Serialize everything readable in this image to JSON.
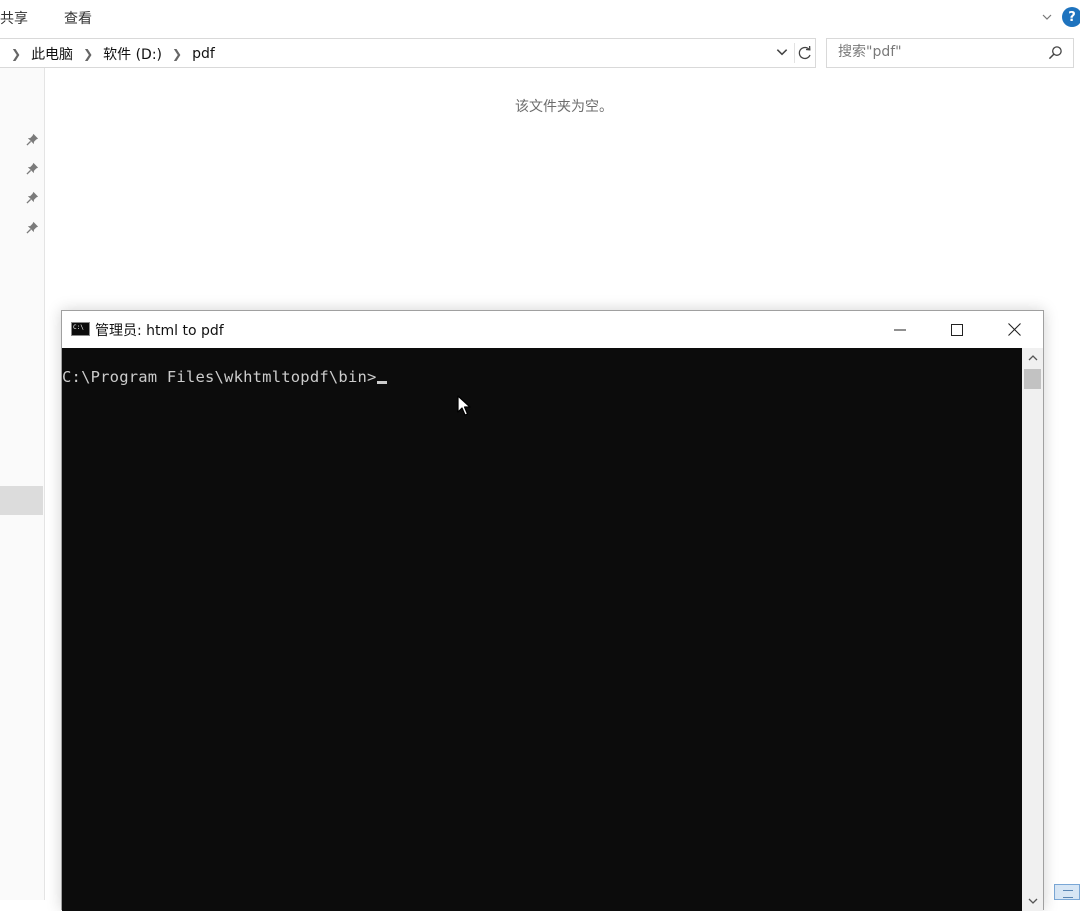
{
  "explorer": {
    "ribbon": {
      "tab_share": "共享",
      "tab_view": "查看",
      "help_label": "?"
    },
    "address": {
      "crumbs": [
        "此电脑",
        "软件 (D:)",
        "pdf"
      ]
    },
    "search": {
      "placeholder": "搜索\"pdf\""
    },
    "empty_message": "该文件夹为空。"
  },
  "cmd_window": {
    "title": "管理员:  html to pdf",
    "icon_text": "C:\\",
    "prompt": "C:\\Program Files\\wkhtmltopdf\\bin>",
    "colors": {
      "console_bg": "#0c0c0c",
      "console_fg": "#cccccc"
    }
  },
  "icons": [
    "chevron-down-icon",
    "help-icon",
    "refresh-icon",
    "search-icon",
    "pin-icon",
    "minimize-icon",
    "maximize-icon",
    "close-icon",
    "cursor-icon"
  ]
}
